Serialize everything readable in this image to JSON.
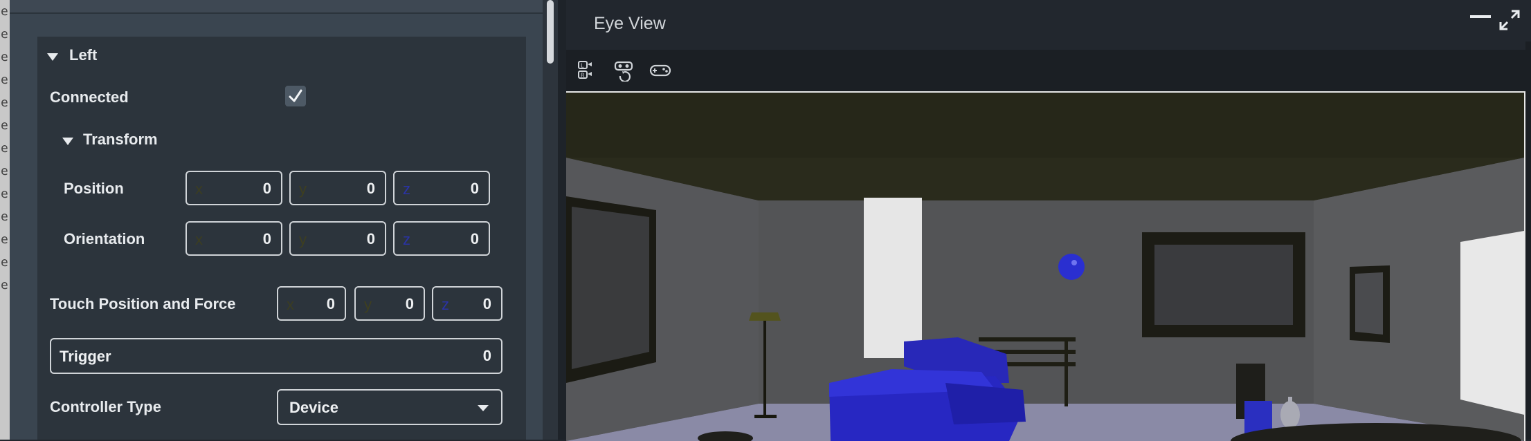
{
  "left_strip": {
    "chars": [
      "e",
      "e",
      "e",
      "e",
      "e",
      "e",
      "e",
      "e",
      "e",
      "e",
      "e",
      "e",
      "e"
    ]
  },
  "inspector": {
    "section_title": "Left",
    "connected_label": "Connected",
    "connected_checked": true,
    "transform": {
      "title": "Transform",
      "position": {
        "label": "Position",
        "x_axis": "x",
        "x": "0",
        "y_axis": "y",
        "y": "0",
        "z_axis": "z",
        "z": "0"
      },
      "orientation": {
        "label": "Orientation",
        "x_axis": "x",
        "x": "0",
        "y_axis": "y",
        "y": "0",
        "z_axis": "z",
        "z": "0"
      }
    },
    "touch": {
      "label": "Touch Position and Force",
      "x_axis": "x",
      "x": "0",
      "y_axis": "y",
      "y": "0",
      "z_axis": "z",
      "z": "0"
    },
    "trigger": {
      "label": "Trigger",
      "value": "0"
    },
    "controller_type": {
      "label": "Controller Type",
      "value": "Device"
    }
  },
  "eye_view": {
    "title": "Eye View",
    "toolbar": [
      {
        "icon": "left-right-camera-icon"
      },
      {
        "icon": "vr-headset-reset-icon"
      },
      {
        "icon": "gamepad-icon"
      }
    ]
  },
  "colors": {
    "axis_x": "#3b3d22",
    "axis_y": "#3e3f1f",
    "axis_z": "#2a33a5",
    "panel_bg": "#2c343c"
  }
}
